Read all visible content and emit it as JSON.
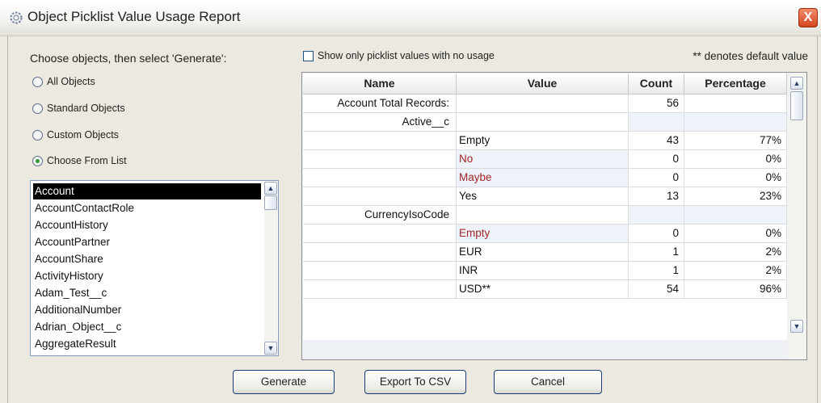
{
  "window": {
    "title": "Object Picklist Value Usage Report",
    "close_label": "X"
  },
  "left_panel": {
    "instruction": "Choose objects, then select 'Generate':",
    "radios": [
      {
        "label": "All Objects",
        "selected": false
      },
      {
        "label": "Standard Objects",
        "selected": false
      },
      {
        "label": "Custom Objects",
        "selected": false
      },
      {
        "label": "Choose From List",
        "selected": true
      }
    ],
    "objects": [
      "Account",
      "AccountContactRole",
      "AccountHistory",
      "AccountPartner",
      "AccountShare",
      "ActivityHistory",
      "Adam_Test__c",
      "AdditionalNumber",
      "Adrian_Object__c",
      "AggregateResult"
    ],
    "selected_object": "Account"
  },
  "filter": {
    "checkbox_label": "Show only picklist values with no usage",
    "checked": false
  },
  "default_note": "** denotes default value",
  "table": {
    "columns": [
      "Name",
      "Value",
      "Count",
      "Percentage"
    ],
    "rows": [
      {
        "name": "Account Total Records:",
        "value": "",
        "count": "56",
        "pct": "",
        "red": false
      },
      {
        "name": "Active__c",
        "value": "",
        "count": "",
        "pct": "",
        "red": false
      },
      {
        "name": "",
        "value": "Empty",
        "count": "43",
        "pct": "77%",
        "red": false
      },
      {
        "name": "",
        "value": "No",
        "count": "0",
        "pct": "0%",
        "red": true
      },
      {
        "name": "",
        "value": "Maybe",
        "count": "0",
        "pct": "0%",
        "red": true
      },
      {
        "name": "",
        "value": "Yes",
        "count": "13",
        "pct": "23%",
        "red": false
      },
      {
        "name": "CurrencyIsoCode",
        "value": "",
        "count": "",
        "pct": "",
        "red": false
      },
      {
        "name": "",
        "value": "Empty",
        "count": "0",
        "pct": "0%",
        "red": true
      },
      {
        "name": "",
        "value": "EUR",
        "count": "1",
        "pct": "2%",
        "red": false
      },
      {
        "name": "",
        "value": "INR",
        "count": "1",
        "pct": "2%",
        "red": false
      },
      {
        "name": "",
        "value": "USD**",
        "count": "54",
        "pct": "96%",
        "red": false
      }
    ]
  },
  "buttons": {
    "generate": "Generate",
    "export": "Export To CSV",
    "cancel": "Cancel"
  },
  "colors": {
    "red_text": "#a32626",
    "selection": "#000000",
    "close": "#d4461f"
  }
}
